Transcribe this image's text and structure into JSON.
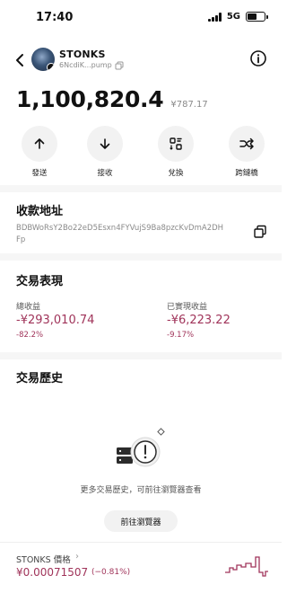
{
  "status": {
    "time": "17:40",
    "network": "5G"
  },
  "header": {
    "token_name": "STONKS",
    "token_address": "6NcdiK...pump"
  },
  "balance": {
    "amount": "1,100,820.4",
    "fiat": "¥787.17"
  },
  "actions": [
    {
      "label": "發送",
      "icon": "arrow-up-icon"
    },
    {
      "label": "接收",
      "icon": "arrow-down-icon"
    },
    {
      "label": "兌換",
      "icon": "swap-icon"
    },
    {
      "label": "跨鏈橋",
      "icon": "bridge-icon"
    }
  ],
  "receive": {
    "title": "收款地址",
    "address": "BDBWoRsY2Bo22eD5Esxn4FYVujS9Ba8pzcKvDmA2DHFp"
  },
  "performance": {
    "title": "交易表現",
    "total_label": "總收益",
    "total_value": "-¥293,010.74",
    "total_pct": "-82.2%",
    "realized_label": "已實現收益",
    "realized_value": "-¥6,223.22",
    "realized_pct": "-9.17%"
  },
  "history": {
    "title": "交易歷史",
    "empty_text": "更多交易歷史，可前往瀏覽器查看",
    "browser_button": "前往瀏覽器"
  },
  "price": {
    "label": "STONKS 價格",
    "chevron": "›",
    "value": "¥0.00071507",
    "change": "(−0.81%)",
    "sparkline_color": "#a0345a"
  },
  "colors": {
    "negative": "#a0345a"
  }
}
